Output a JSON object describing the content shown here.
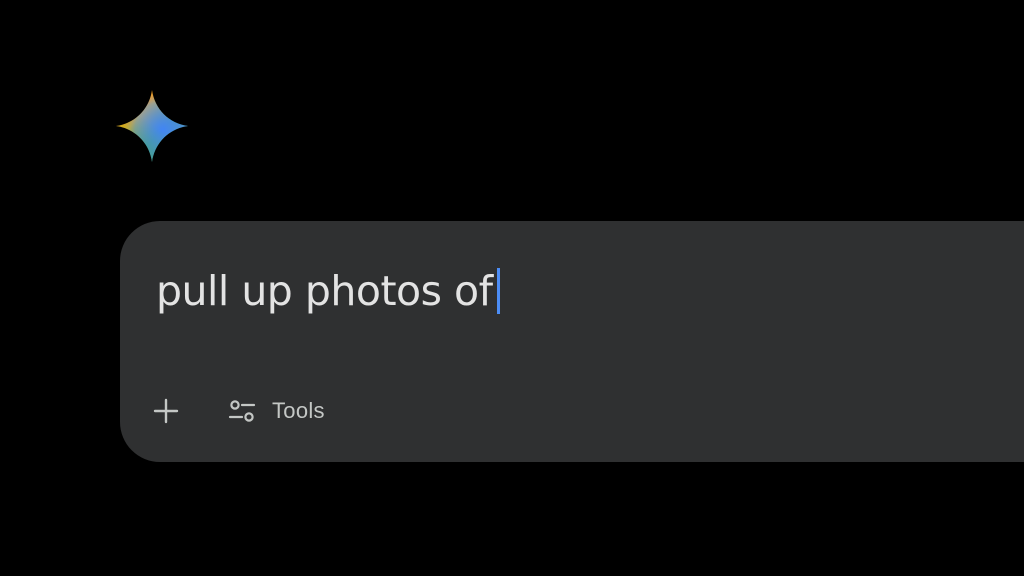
{
  "assistant": {
    "logo_icon": "gemini-sparkle-icon",
    "logo_colors": [
      "#f4443e",
      "#fbbc04",
      "#34a853",
      "#4285f4",
      "#8e6cef"
    ]
  },
  "prompt": {
    "value": "pull up photos of",
    "caret_color": "#4c8df6"
  },
  "toolbar": {
    "add_icon": "plus-icon",
    "tools_icon": "sliders-icon",
    "tools_label": "Tools"
  }
}
